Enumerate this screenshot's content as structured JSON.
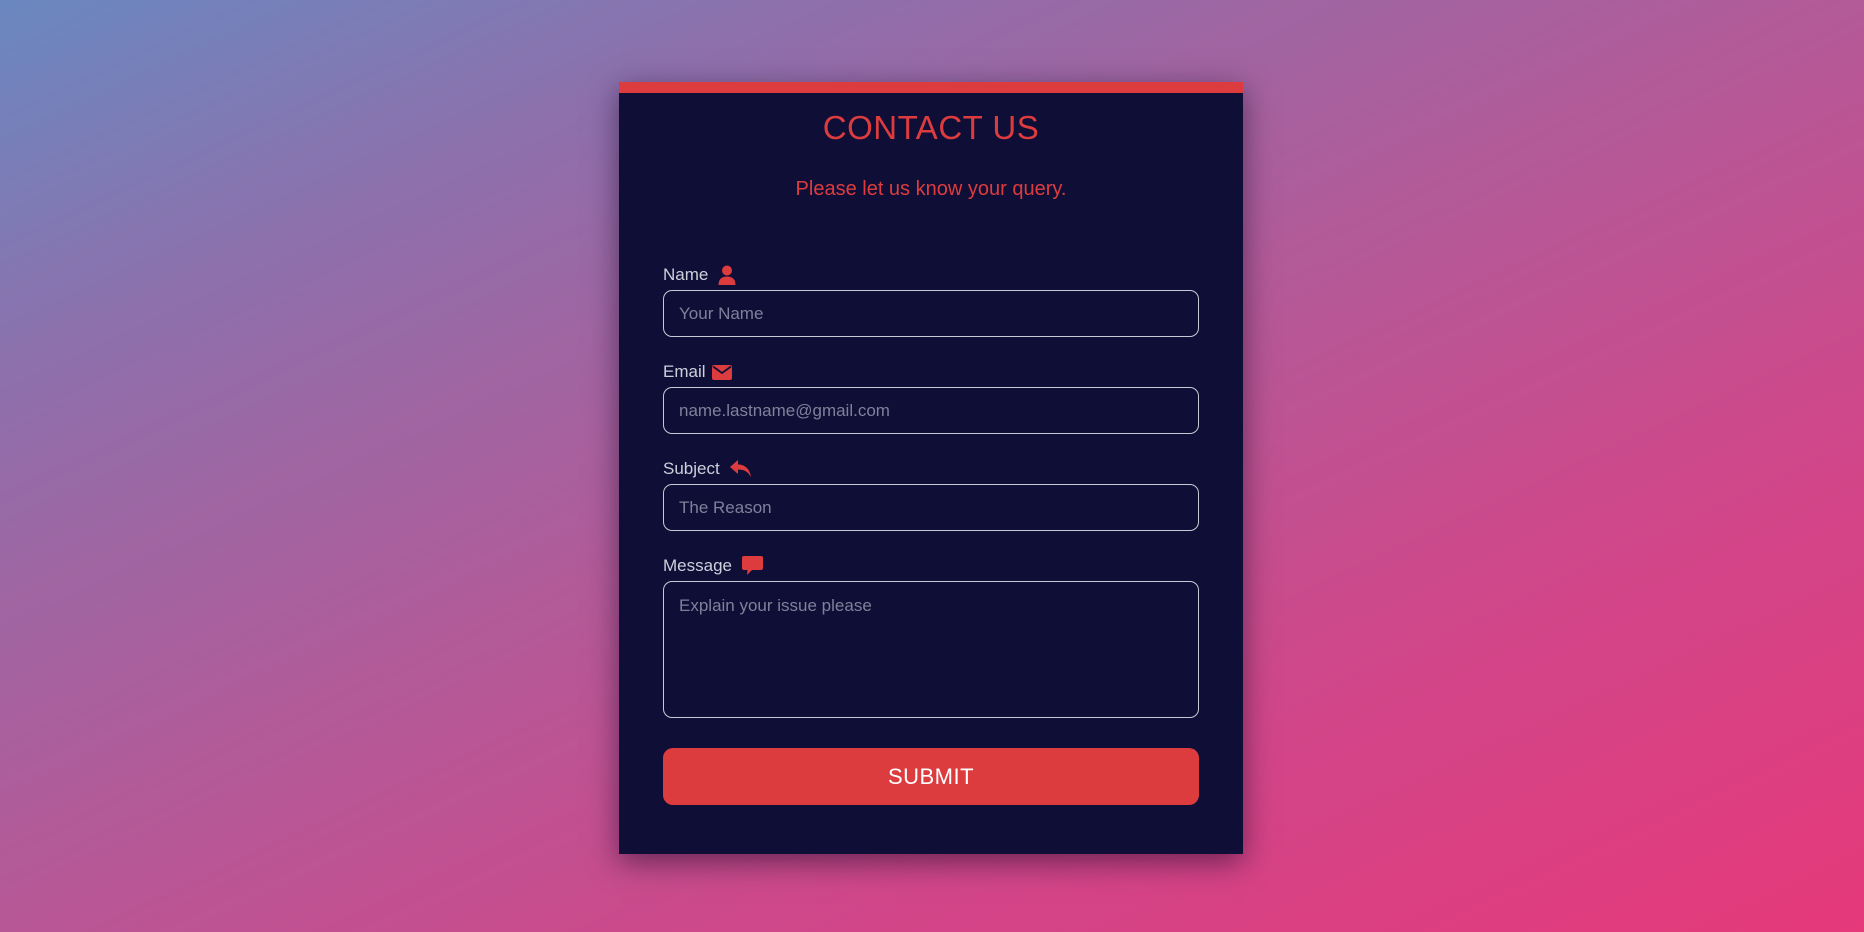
{
  "colors": {
    "accent": "#dd3c3f",
    "card_background": "#0f0e36",
    "label_text": "#cfcfdc"
  },
  "header": {
    "title": "CONTACT US",
    "subtitle": "Please let us know your query."
  },
  "form": {
    "name": {
      "label": "Name",
      "icon": "user-icon",
      "value": "",
      "placeholder": "Your Name"
    },
    "email": {
      "label": "Email",
      "icon": "envelope-icon",
      "value": "",
      "placeholder": "name.lastname@gmail.com"
    },
    "subject": {
      "label": "Subject",
      "icon": "reply-icon",
      "value": "",
      "placeholder": "The Reason"
    },
    "message": {
      "label": "Message",
      "icon": "comment-icon",
      "value": "",
      "placeholder": "Explain your issue please"
    },
    "submit_label": "SUBMIT"
  }
}
